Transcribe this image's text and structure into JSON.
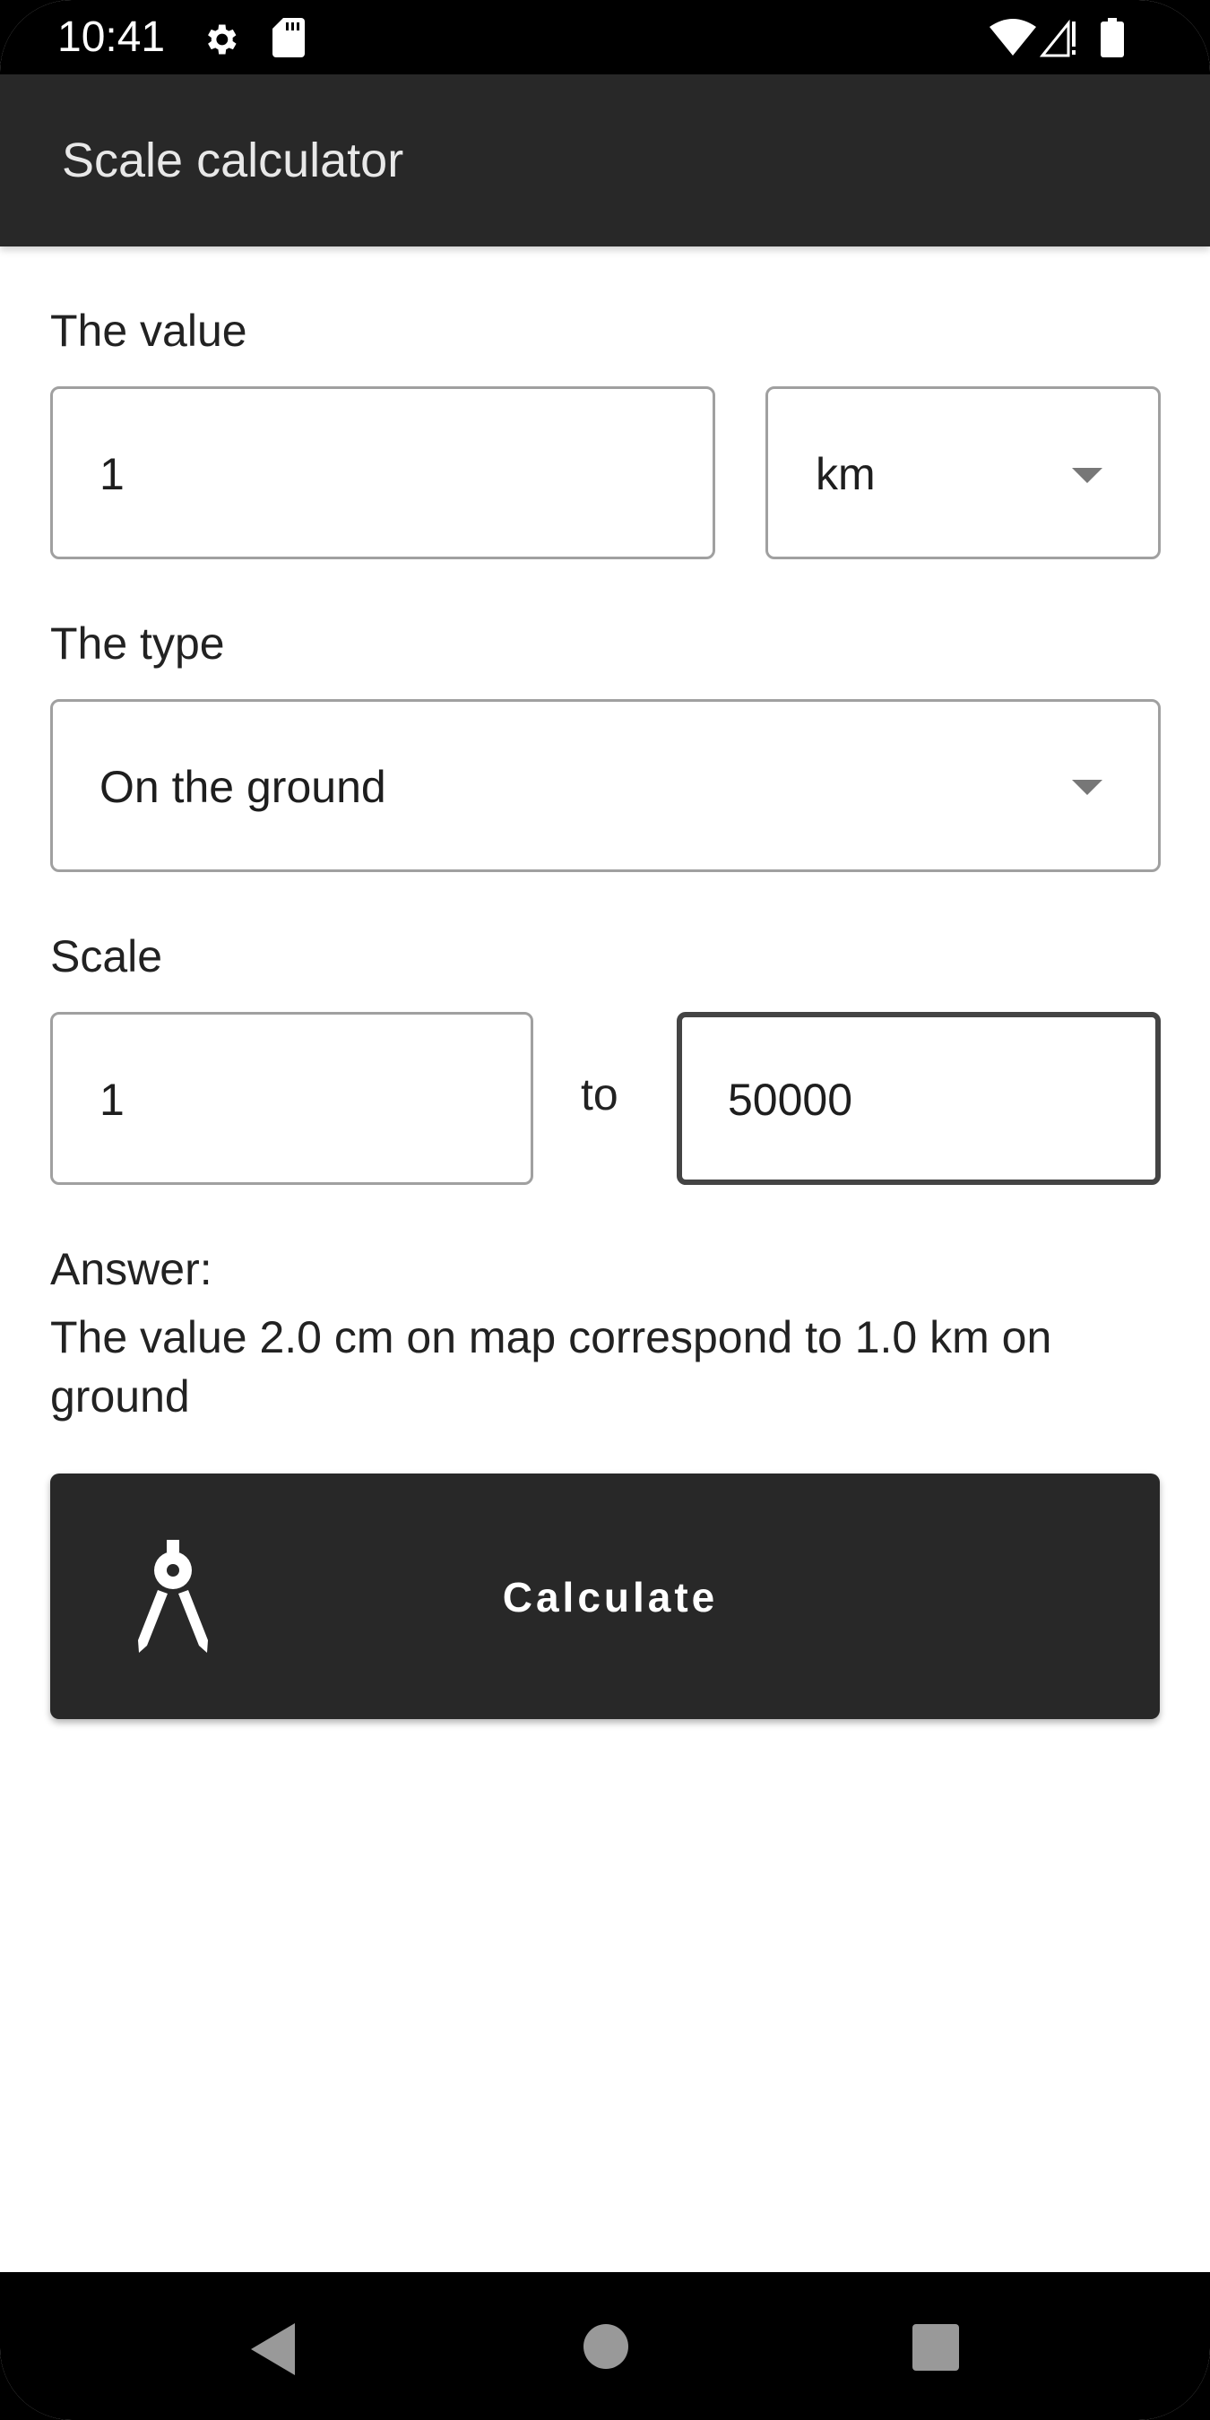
{
  "status_bar": {
    "time": "10:41",
    "left_icons": [
      "settings-gear-icon",
      "sd-card-icon"
    ],
    "right_icons": [
      "wifi-icon",
      "cellular-no-signal-icon",
      "battery-icon"
    ]
  },
  "app_bar": {
    "title": "Scale calculator"
  },
  "form": {
    "value_label": "The value",
    "value_input": "1",
    "unit_selected": "km",
    "type_label": "The type",
    "type_selected": "On the ground",
    "scale_label": "Scale",
    "scale_left_input": "1",
    "scale_separator": "to",
    "scale_right_input": "50000"
  },
  "answer": {
    "title": "Answer:",
    "text": "The value 2.0 cm on map correspond to 1.0 km on ground"
  },
  "calculate_button": {
    "label": "Calculate",
    "icon": "compass-drafting-icon"
  },
  "nav_bar": {
    "buttons": [
      "back",
      "home",
      "recents"
    ]
  },
  "colors": {
    "app_bar": "#282828",
    "button": "#282828",
    "field_border": "#a0a0a0",
    "field_border_focused": "#444444",
    "dropdown_caret": "#777777"
  }
}
